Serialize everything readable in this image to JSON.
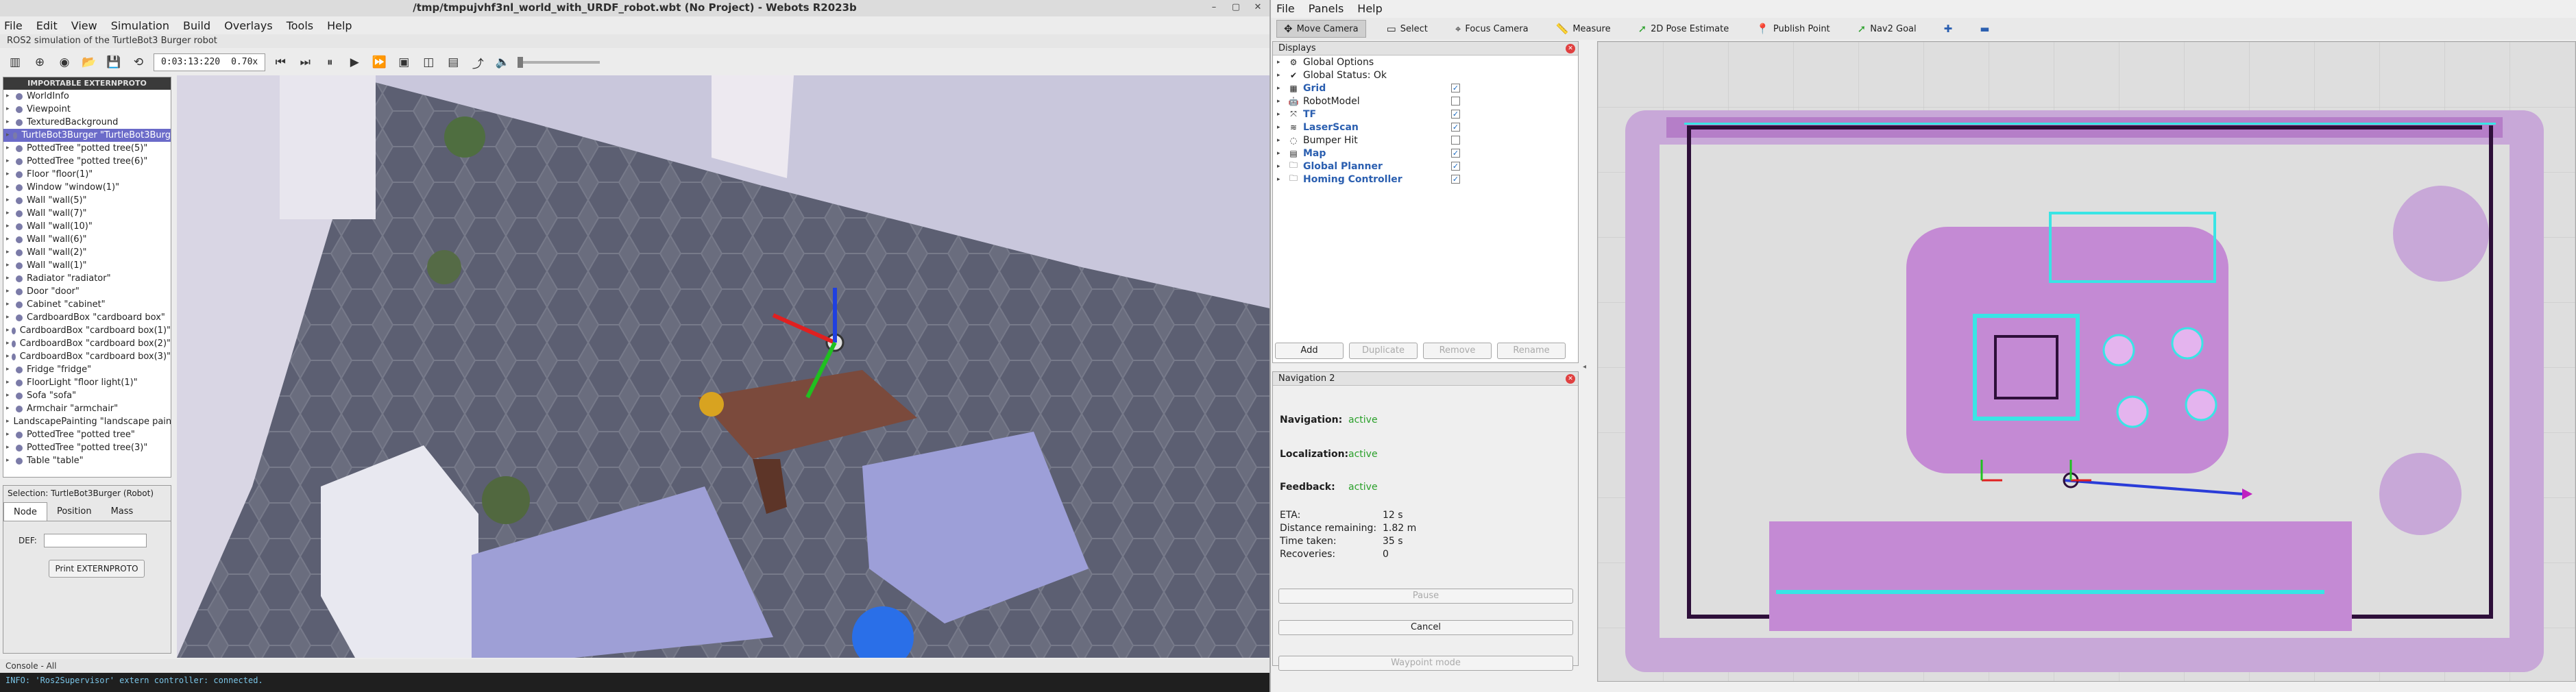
{
  "webots": {
    "window_title": "/tmp/tmpujvhf3nl_world_with_URDF_robot.wbt (No Project) - Webots R2023b",
    "menu": [
      "File",
      "Edit",
      "View",
      "Simulation",
      "Build",
      "Overlays",
      "Tools",
      "Help"
    ],
    "subtitle": "ROS2 simulation of the TurtleBot3 Burger robot",
    "clock": {
      "time": "0:03:13:220",
      "speed": "0.70x"
    },
    "scene_tree": {
      "header": "IMPORTABLE EXTERNPROTO",
      "items": [
        "WorldInfo",
        "Viewpoint",
        "TexturedBackground",
        "TurtleBot3Burger \"TurtleBot3Burg",
        "PottedTree \"potted tree(5)\"",
        "PottedTree \"potted tree(6)\"",
        "Floor \"floor(1)\"",
        "Window \"window(1)\"",
        "Wall \"wall(5)\"",
        "Wall \"wall(7)\"",
        "Wall \"wall(10)\"",
        "Wall \"wall(6)\"",
        "Wall \"wall(2)\"",
        "Wall \"wall(1)\"",
        "Radiator \"radiator\"",
        "Door \"door\"",
        "Cabinet \"cabinet\"",
        "CardboardBox \"cardboard box\"",
        "CardboardBox \"cardboard box(1)\"",
        "CardboardBox \"cardboard box(2)\"",
        "CardboardBox \"cardboard box(3)\"",
        "Fridge \"fridge\"",
        "FloorLight \"floor light(1)\"",
        "Sofa \"sofa\"",
        "Armchair \"armchair\"",
        "LandscapePainting \"landscape pain",
        "PottedTree \"potted tree\"",
        "PottedTree \"potted tree(3)\"",
        "Table \"table\""
      ],
      "selected_index": 3
    },
    "selection": {
      "title": "Selection: TurtleBot3Burger (Robot)",
      "tabs": [
        "Node",
        "Position",
        "Mass"
      ],
      "def_label": "DEF:",
      "def_value": "",
      "print_button": "Print EXTERNPROTO"
    },
    "console": {
      "header": "Console - All",
      "line": "INFO: 'Ros2Supervisor' extern controller: connected."
    }
  },
  "rviz": {
    "menu": [
      "File",
      "Panels",
      "Help"
    ],
    "tools": [
      {
        "label": "Move Camera",
        "icon": "move-camera-icon",
        "active": true
      },
      {
        "label": "Select",
        "icon": "select-icon",
        "active": false
      },
      {
        "label": "Focus Camera",
        "icon": "focus-camera-icon",
        "active": false
      },
      {
        "label": "Measure",
        "icon": "measure-icon",
        "active": false
      },
      {
        "label": "2D Pose Estimate",
        "icon": "pose-estimate-icon",
        "active": false
      },
      {
        "label": "Publish Point",
        "icon": "publish-point-icon",
        "active": false
      },
      {
        "label": "Nav2 Goal",
        "icon": "nav2-goal-icon",
        "active": false
      }
    ],
    "displays": {
      "title": "Displays",
      "items": [
        {
          "label": "Global Options",
          "checked": null,
          "blue": false,
          "icon": "globe-icon"
        },
        {
          "label": "Global Status: Ok",
          "checked": null,
          "blue": false,
          "icon": "check-icon"
        },
        {
          "label": "Grid",
          "checked": true,
          "blue": true,
          "icon": "grid-icon"
        },
        {
          "label": "RobotModel",
          "checked": false,
          "blue": false,
          "icon": "robot-model-icon"
        },
        {
          "label": "TF",
          "checked": true,
          "blue": true,
          "icon": "tf-icon"
        },
        {
          "label": "LaserScan",
          "checked": true,
          "blue": true,
          "icon": "laser-scan-icon"
        },
        {
          "label": "Bumper Hit",
          "checked": false,
          "blue": false,
          "icon": "bumper-icon"
        },
        {
          "label": "Map",
          "checked": true,
          "blue": true,
          "icon": "map-icon"
        },
        {
          "label": "Global Planner",
          "checked": true,
          "blue": true,
          "icon": "folder-icon"
        },
        {
          "label": "Homing Controller",
          "checked": true,
          "blue": true,
          "icon": "folder-icon"
        }
      ],
      "buttons": [
        "Add",
        "Duplicate",
        "Remove",
        "Rename"
      ]
    },
    "nav2": {
      "title": "Navigation 2",
      "navigation": {
        "label": "Navigation:",
        "value": "active"
      },
      "localization": {
        "label": "Localization:",
        "value": "active"
      },
      "feedback": {
        "label": "Feedback:",
        "value": "active"
      },
      "info": [
        {
          "k": "ETA:",
          "v": "12 s"
        },
        {
          "k": "Distance remaining:",
          "v": "1.82 m"
        },
        {
          "k": "Time taken:",
          "v": "35 s"
        },
        {
          "k": "Recoveries:",
          "v": "0"
        }
      ],
      "pause": "Pause",
      "cancel": "Cancel",
      "waypoint": "Waypoint mode"
    }
  }
}
